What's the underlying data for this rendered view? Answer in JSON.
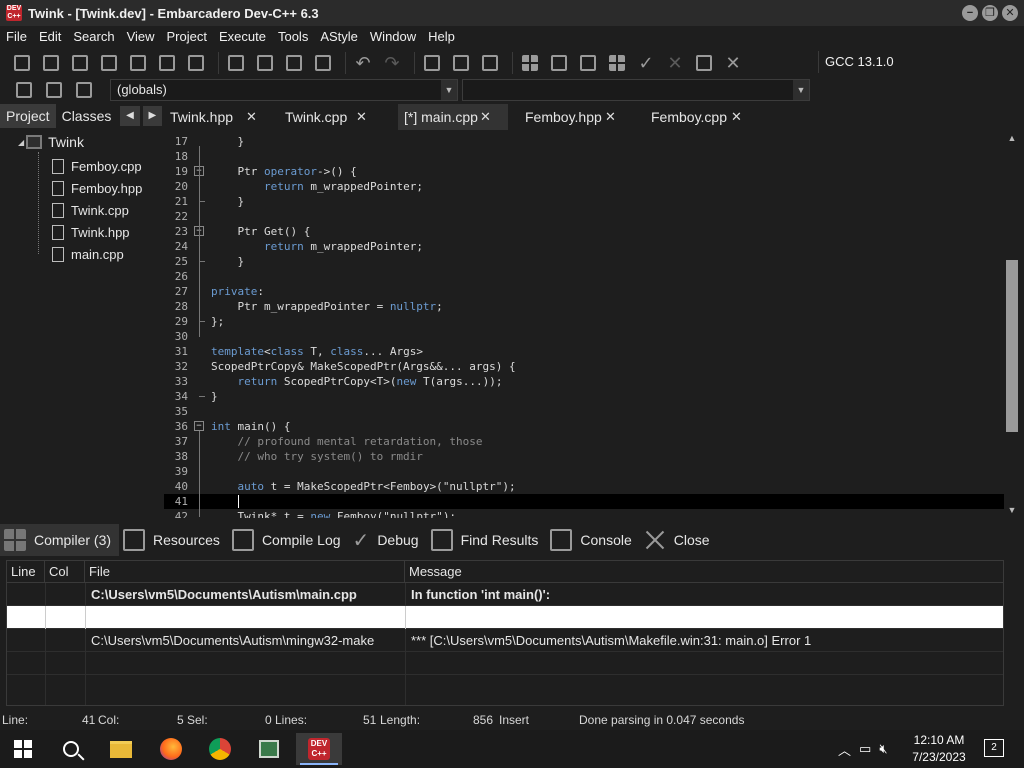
{
  "window": {
    "title": "Twink - [Twink.dev] - Embarcadero Dev-C++ 6.3",
    "logo_text": "DEV C++"
  },
  "menu": [
    "File",
    "Edit",
    "Search",
    "View",
    "Project",
    "Execute",
    "Tools",
    "AStyle",
    "Window",
    "Help"
  ],
  "toolbar": {
    "compiler": "GCC 13.1.0",
    "scope_select": "(globals)"
  },
  "left_panel": {
    "tabs": [
      "Project",
      "Classes"
    ],
    "root": "Twink",
    "files": [
      "Femboy.cpp",
      "Femboy.hpp",
      "Twink.cpp",
      "Twink.hpp",
      "main.cpp"
    ]
  },
  "editor_tabs": [
    "Twink.hpp",
    "Twink.cpp",
    "[*] main.cpp",
    "Femboy.hpp",
    "Femboy.cpp"
  ],
  "code": [
    {
      "n": "17",
      "parts": [
        [
          "",
          "    }"
        ]
      ]
    },
    {
      "n": "18",
      "parts": [
        [
          "",
          ""
        ]
      ]
    },
    {
      "n": "19",
      "parts": [
        [
          "",
          "    Ptr "
        ],
        [
          "kw",
          "operator"
        ],
        [
          "",
          "->() {"
        ]
      ]
    },
    {
      "n": "20",
      "parts": [
        [
          "",
          "        "
        ],
        [
          "kw",
          "return"
        ],
        [
          "",
          " m_wrappedPointer;"
        ]
      ]
    },
    {
      "n": "21",
      "parts": [
        [
          "",
          "    }"
        ]
      ]
    },
    {
      "n": "22",
      "parts": [
        [
          "",
          ""
        ]
      ]
    },
    {
      "n": "23",
      "parts": [
        [
          "",
          "    Ptr Get() {"
        ]
      ]
    },
    {
      "n": "24",
      "parts": [
        [
          "",
          "        "
        ],
        [
          "kw",
          "return"
        ],
        [
          "",
          " m_wrappedPointer;"
        ]
      ]
    },
    {
      "n": "25",
      "parts": [
        [
          "",
          "    }"
        ]
      ]
    },
    {
      "n": "26",
      "parts": [
        [
          "",
          ""
        ]
      ]
    },
    {
      "n": "27",
      "parts": [
        [
          "kw",
          "private"
        ],
        [
          "",
          ":"
        ]
      ]
    },
    {
      "n": "28",
      "parts": [
        [
          "",
          "    Ptr m_wrappedPointer = "
        ],
        [
          "kw",
          "nullptr"
        ],
        [
          "",
          ";"
        ]
      ]
    },
    {
      "n": "29",
      "parts": [
        [
          "",
          "};"
        ]
      ]
    },
    {
      "n": "30",
      "parts": [
        [
          "",
          ""
        ]
      ]
    },
    {
      "n": "31",
      "parts": [
        [
          "kw",
          "template"
        ],
        [
          "",
          "<"
        ],
        [
          "kw",
          "class"
        ],
        [
          "",
          " T, "
        ],
        [
          "kw",
          "class"
        ],
        [
          "",
          "... Args>"
        ]
      ]
    },
    {
      "n": "32",
      "parts": [
        [
          "",
          "ScopedPtrCopy& MakeScopedPtr(Args&&... args) {"
        ]
      ]
    },
    {
      "n": "33",
      "parts": [
        [
          "",
          "    "
        ],
        [
          "kw",
          "return"
        ],
        [
          "",
          " ScopedPtrCopy<T>("
        ],
        [
          "kw",
          "new"
        ],
        [
          "",
          " T(args...));"
        ]
      ]
    },
    {
      "n": "34",
      "parts": [
        [
          "",
          "}"
        ]
      ]
    },
    {
      "n": "35",
      "parts": [
        [
          "",
          ""
        ]
      ]
    },
    {
      "n": "36",
      "parts": [
        [
          "kw",
          "int"
        ],
        [
          "",
          " main() {"
        ]
      ]
    },
    {
      "n": "37",
      "parts": [
        [
          "cm",
          "    // profound mental retardation, those"
        ]
      ]
    },
    {
      "n": "38",
      "parts": [
        [
          "cm",
          "    // who try system() to rmdir"
        ]
      ]
    },
    {
      "n": "39",
      "parts": [
        [
          "",
          ""
        ]
      ]
    },
    {
      "n": "40",
      "parts": [
        [
          "",
          "    "
        ],
        [
          "kw",
          "auto"
        ],
        [
          "",
          " t = MakeScopedPtr<Femboy>("
        ],
        [
          "st",
          "\"nullptr\""
        ],
        [
          "",
          ");"
        ]
      ]
    },
    {
      "n": "41",
      "parts": [
        [
          "",
          ""
        ]
      ]
    },
    {
      "n": "42",
      "parts": [
        [
          "",
          "    Twink* t = "
        ],
        [
          "kw",
          "new"
        ],
        [
          "",
          " Femboy("
        ],
        [
          "st",
          "\"nullptr\""
        ],
        [
          "",
          ");"
        ]
      ]
    }
  ],
  "bottom_tabs": [
    "Compiler (3)",
    "Resources",
    "Compile Log",
    "Debug",
    "Find Results",
    "Console",
    "Close"
  ],
  "messages": {
    "headers": [
      "Line",
      "Col",
      "File",
      "Message"
    ],
    "rows": [
      {
        "line": "",
        "col": "",
        "file": "C:\\Users\\vm5\\Documents\\Autism\\main.cpp",
        "message": "In function 'int main()':",
        "bold": true
      },
      {
        "line": "",
        "col": "",
        "file": "",
        "message": "",
        "selected": true
      },
      {
        "line": "",
        "col": "",
        "file": "C:\\Users\\vm5\\Documents\\Autism\\mingw32-make",
        "message": "*** [C:\\Users\\vm5\\Documents\\Autism\\Makefile.win:31: main.o] Error 1"
      }
    ]
  },
  "status": {
    "line_label": "Line:",
    "line_val": "41",
    "col_label": "Col:",
    "col_val": "5",
    "sel_label": "Sel:",
    "sel_val": "0",
    "lines_label": "Lines:",
    "lines_val": "51",
    "length_label": "Length:",
    "length_val": "856",
    "mode": "Insert",
    "parse_msg": "Done parsing in 0.047 seconds"
  },
  "taskbar": {
    "time": "12:10 AM",
    "date": "7/23/2023",
    "notifications": "2"
  }
}
